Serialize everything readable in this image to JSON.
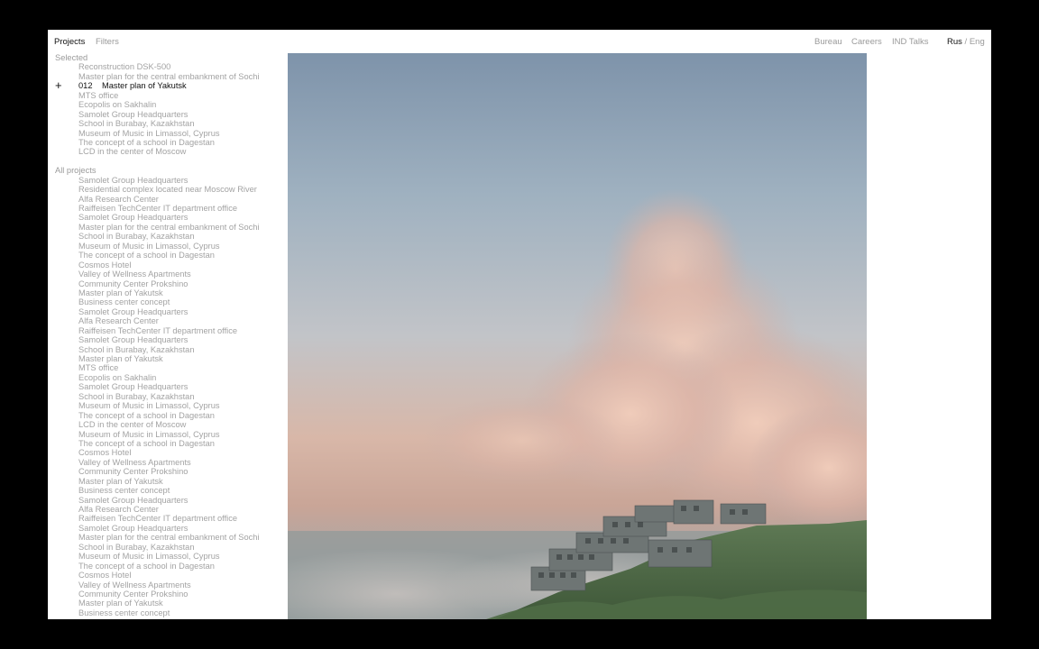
{
  "nav": {
    "projects": "Projects",
    "filters": "Filters",
    "bureau": "Bureau",
    "careers": "Careers",
    "talks": "IND Talks",
    "lang_rus": "Rus",
    "lang_sep": " / ",
    "lang_eng": "Eng"
  },
  "selected": {
    "label": "Selected",
    "items": [
      "Reconstruction DSK-500",
      "Master plan for the central embankment of Sochi",
      "Master plan of Yakutsk",
      "MTS office",
      "Ecopolis on Sakhalin",
      "Samolet Group Headquarters",
      "School in Burabay, Kazakhstan",
      "Museum of Music in Limassol, Cyprus",
      "The concept of a school in Dagestan",
      "LCD in the center of Moscow"
    ],
    "active_number": "012",
    "active_marker": "+"
  },
  "all": {
    "label": "All projects",
    "items": [
      "Samolet Group Headquarters",
      "Residential complex located near Moscow River",
      "Alfa Research Center",
      "Raiffeisen TechCenter IT department office",
      "Samolet Group Headquarters",
      "Master plan for the central embankment of Sochi",
      "School in Burabay, Kazakhstan",
      "Museum of Music in Limassol, Cyprus",
      "The concept of a school in Dagestan",
      "Cosmos Hotel",
      "Valley of Wellness Apartments",
      "Community Center Prokshino",
      "Master plan of Yakutsk",
      "Business center concept",
      "Samolet Group Headquarters",
      "Alfa Research Center",
      "Raiffeisen TechCenter IT department office",
      "Samolet Group Headquarters",
      "School in Burabay, Kazakhstan",
      "Master plan of Yakutsk",
      "MTS office",
      "Ecopolis on Sakhalin",
      "Samolet Group Headquarters",
      "School in Burabay, Kazakhstan",
      "Museum of Music in Limassol, Cyprus",
      "The concept of a school in Dagestan",
      "LCD in the center of Moscow",
      "Museum of Music in Limassol, Cyprus",
      "The concept of a school in Dagestan",
      "Cosmos Hotel",
      "Valley of Wellness Apartments",
      "Community Center Prokshino",
      "Master plan of Yakutsk",
      "Business center concept",
      "Samolet Group Headquarters",
      "Alfa Research Center",
      "Raiffeisen TechCenter IT department office",
      "Samolet Group Headquarters",
      "Master plan for the central embankment of Sochi",
      "School in Burabay, Kazakhstan",
      "Museum of Music in Limassol, Cyprus",
      "The concept of a school in Dagestan",
      "Cosmos Hotel",
      "Valley of Wellness Apartments",
      "Community Center Prokshino",
      "Master plan of Yakutsk",
      "Business center concept"
    ]
  },
  "colors": {
    "text_active": "#111111",
    "text_muted": "#a3a3a3",
    "frame": "#000000"
  }
}
